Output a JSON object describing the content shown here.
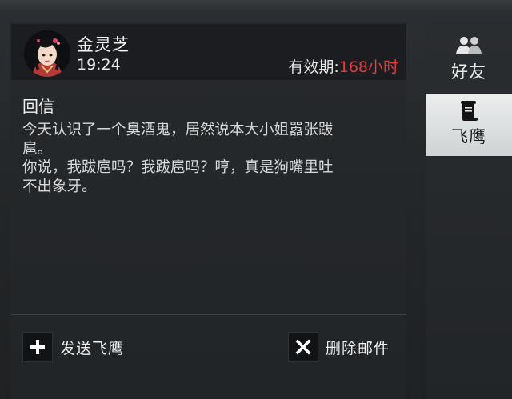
{
  "mail": {
    "sender_name": "金灵芝",
    "time": "19:24",
    "validity_label": "有效期:",
    "validity_hours": "168小时",
    "subject": "回信",
    "body": "今天认识了一个臭酒鬼，居然说本大小姐嚣张跋\n扈。\n你说，我跋扈吗？我跋扈吗？哼，真是狗嘴里吐\n不出象牙。"
  },
  "actions": {
    "send_label": "发送飞鹰",
    "delete_label": "删除邮件"
  },
  "tabs": [
    {
      "label": "好友",
      "icon": "friends-icon",
      "selected": false
    },
    {
      "label": "飞鹰",
      "icon": "scroll-icon",
      "selected": true
    }
  ],
  "colors": {
    "validity_hours": "#e23b3b",
    "selected_tab": "#e3e5e6"
  }
}
